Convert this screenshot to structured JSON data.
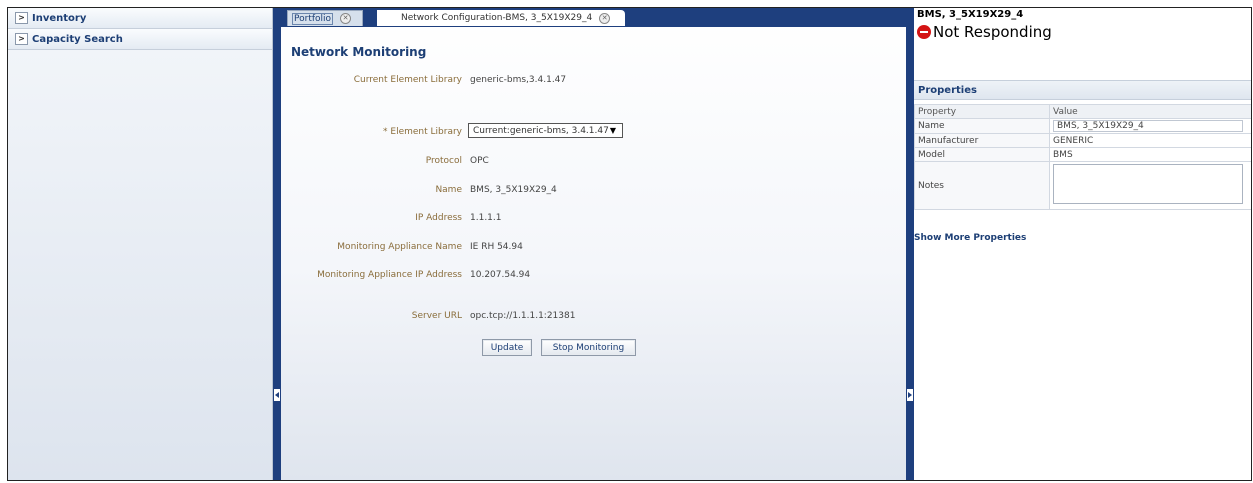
{
  "nav": {
    "items": [
      {
        "label": "Inventory"
      },
      {
        "label": "Capacity Search"
      }
    ]
  },
  "tabs": [
    {
      "label": "Portfolio"
    },
    {
      "label": "Network Configuration-BMS, 3_5X19X29_4"
    }
  ],
  "monitoring": {
    "title": "Network Monitoring",
    "fields": {
      "current_element_library": {
        "label": "Current Element Library",
        "value": "generic-bms,3.4.1.47"
      },
      "element_library": {
        "label": "* Element Library",
        "value": "Current:generic-bms, 3.4.1.47"
      },
      "protocol": {
        "label": "Protocol",
        "value": "OPC"
      },
      "name": {
        "label": "Name",
        "value": "BMS, 3_5X19X29_4"
      },
      "ip_address": {
        "label": "IP Address",
        "value": "1.1.1.1"
      },
      "appliance_name": {
        "label": "Monitoring Appliance Name",
        "value": "IE RH 54.94"
      },
      "appliance_ip": {
        "label": "Monitoring Appliance IP Address",
        "value": "10.207.54.94"
      },
      "server_url": {
        "label": "Server URL",
        "value": "opc.tcp://1.1.1.1:21381"
      }
    },
    "buttons": {
      "update": "Update",
      "stop": "Stop Monitoring"
    }
  },
  "details": {
    "title": "BMS, 3_5X19X29_4",
    "status": "Not Responding",
    "status_color": "#d41414",
    "properties_header": "Properties",
    "columns": {
      "property": "Property",
      "value": "Value"
    },
    "rows": {
      "name": {
        "label": "Name",
        "value": "BMS, 3_5X19X29_4"
      },
      "manufacturer": {
        "label": "Manufacturer",
        "value": "GENERIC"
      },
      "model": {
        "label": "Model",
        "value": "BMS"
      },
      "notes": {
        "label": "Notes",
        "value": ""
      }
    },
    "show_more": "Show More Properties"
  },
  "colors": {
    "accent": "#1e3f7e",
    "label": "#8a6d3b",
    "heading": "#1d3f75"
  }
}
